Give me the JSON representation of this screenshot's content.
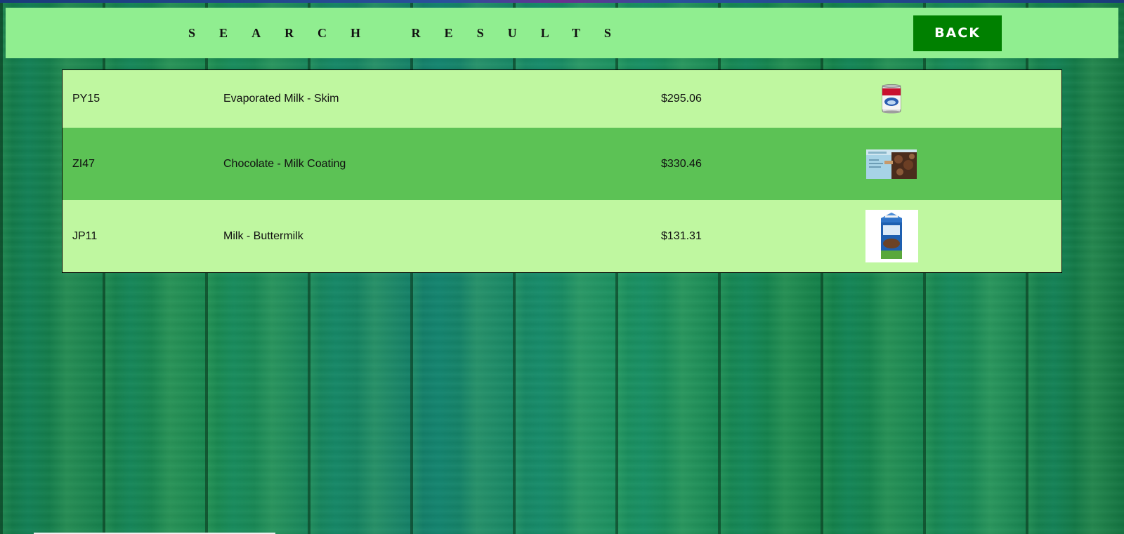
{
  "header": {
    "title": "SEARCH RESULTS",
    "back_label": "BACK",
    "background_color": "#90ee90",
    "back_color": "#008000"
  },
  "results": [
    {
      "code": "PY15",
      "name": "Evaporated Milk - Skim",
      "price": "$295.06",
      "image": "can-of-evaporated-milk"
    },
    {
      "code": "ZI47",
      "name": "Chocolate - Milk Coating",
      "price": "$330.46",
      "image": "box-of-milk-chocolate-chips"
    },
    {
      "code": "JP11",
      "name": "Milk - Buttermilk",
      "price": "$131.31",
      "image": "carton-of-buttermilk"
    }
  ],
  "colors": {
    "row_light": "#bff7a0",
    "row_dark": "#5cc255",
    "page_background": "green-wood-planks"
  }
}
